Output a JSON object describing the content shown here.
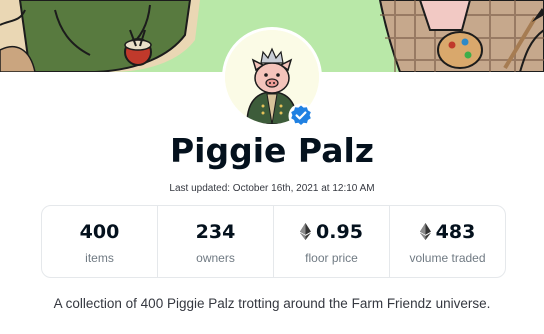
{
  "collection": {
    "name": "Piggie Palz",
    "last_updated": "Last updated: October 16th, 2021 at 12:10 AM",
    "description": "A collection of 400 Piggie Palz trotting around the Farm Friendz universe.",
    "verified": true
  },
  "stats": [
    {
      "value": "400",
      "label": "items",
      "icon": ""
    },
    {
      "value": "234",
      "label": "owners",
      "icon": ""
    },
    {
      "value": "0.95",
      "label": "floor price",
      "icon": "eth-icon"
    },
    {
      "value": "483",
      "label": "volume traded",
      "icon": "eth-icon"
    }
  ],
  "colors": {
    "banner_green": "#b9e8a8",
    "verified_blue": "#2081e2",
    "text_primary": "#04111d",
    "text_secondary": "#707a83",
    "border": "#e5e8eb"
  }
}
